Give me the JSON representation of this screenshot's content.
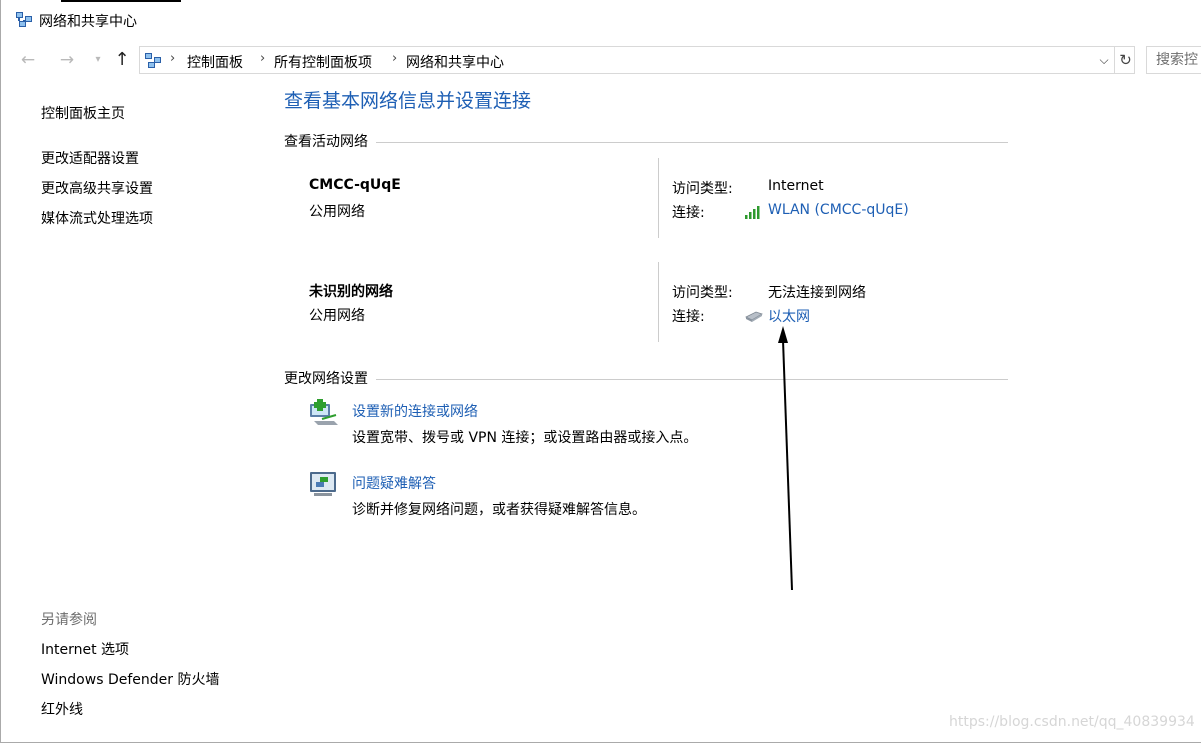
{
  "window": {
    "title": "网络和共享中心"
  },
  "nav": {
    "back": "←",
    "forward": "→",
    "recent": "▾",
    "up": "↑",
    "breadcrumbs": [
      "控制面板",
      "所有控制面板项",
      "网络和共享中心"
    ],
    "dropdown": "⌵",
    "refresh": "↻",
    "search_placeholder": "搜索控"
  },
  "sidebar": {
    "home": "控制面板主页",
    "links": [
      "更改适配器设置",
      "更改高级共享设置",
      "媒体流式处理选项"
    ],
    "see_also_heading": "另请参阅",
    "see_also": [
      "Internet 选项",
      "Windows Defender 防火墙",
      "红外线"
    ]
  },
  "main": {
    "title": "查看基本网络信息并设置连接",
    "active_heading": "查看活动网络",
    "networks": [
      {
        "name": "CMCC-qUqE",
        "type": "公用网络",
        "access_label": "访问类型:",
        "access_value": "Internet",
        "connection_label": "连接:",
        "connection_value": "WLAN (CMCC-qUqE)",
        "connection_icon": "wifi-signal-icon"
      },
      {
        "name": "未识别的网络",
        "type": "公用网络",
        "access_label": "访问类型:",
        "access_value": "无法连接到网络",
        "connection_label": "连接:",
        "connection_value": "以太网",
        "connection_icon": "ethernet-icon"
      }
    ],
    "change_heading": "更改网络设置",
    "tasks": [
      {
        "link": "设置新的连接或网络",
        "desc": "设置宽带、拨号或 VPN 连接；或设置路由器或接入点。",
        "icon": "new-connection-icon"
      },
      {
        "link": "问题疑难解答",
        "desc": "诊断并修复网络问题，或者获得疑难解答信息。",
        "icon": "troubleshoot-icon"
      }
    ]
  },
  "watermark": "https://blog.csdn.net/qq_40839934",
  "colors": {
    "link": "#1e5fb4",
    "rule": "#cccccc",
    "muted": "#6d6d6d"
  }
}
